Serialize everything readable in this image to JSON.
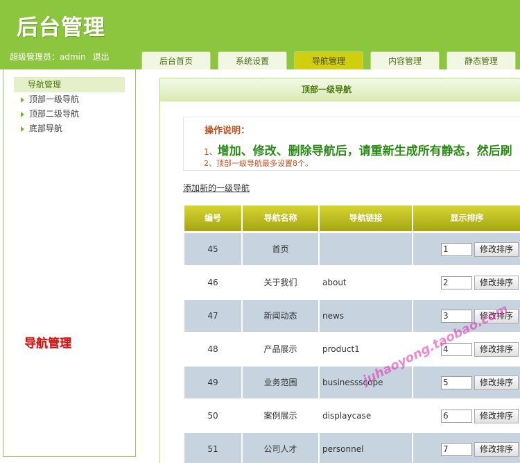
{
  "header": {
    "logo": "后台管理",
    "admin_text": "超级管理员：admin",
    "logout": "退出"
  },
  "tabs": [
    {
      "label": "后台首页",
      "active": false
    },
    {
      "label": "系统设置",
      "active": false
    },
    {
      "label": "导航管理",
      "active": true
    },
    {
      "label": "内容管理",
      "active": false
    },
    {
      "label": "静态管理",
      "active": false
    }
  ],
  "sidebar": {
    "title": "导航管理",
    "items": [
      {
        "label": "顶部一级导航"
      },
      {
        "label": "顶部二级导航"
      },
      {
        "label": "底部导航"
      }
    ],
    "side_label": "导航管理"
  },
  "panel": {
    "title": "顶部一级导航",
    "notice_title": "操作说明：",
    "notice_num1": "1、",
    "notice_line1": "增加、修改、删除导航后，请重新生成所有静态，然后刷",
    "notice_line2": "2、顶部一级导航最多设置8个。",
    "add_link": "添加新的一级导航"
  },
  "table": {
    "headers": [
      "编号",
      "导航名称",
      "导航链接",
      "显示排序"
    ],
    "button_label": "修改排序",
    "rows": [
      {
        "id": "45",
        "name": "首页",
        "link": "",
        "order": "1"
      },
      {
        "id": "46",
        "name": "关于我们",
        "link": "about",
        "order": "2"
      },
      {
        "id": "47",
        "name": "新闻动态",
        "link": "news",
        "order": "3"
      },
      {
        "id": "48",
        "name": "产品展示",
        "link": "product1",
        "order": "4"
      },
      {
        "id": "49",
        "name": "业务范围",
        "link": "businessscope",
        "order": "5"
      },
      {
        "id": "50",
        "name": "案例展示",
        "link": "displaycase",
        "order": "6"
      },
      {
        "id": "51",
        "name": "公司人才",
        "link": "personnel",
        "order": "7"
      }
    ]
  },
  "watermark": "juhaoyong.taobao.com",
  "colors": {
    "header_green": "#8cc63e",
    "tab_active": "#cfcf10",
    "row_alt": "#c7d4e0",
    "notice_orange": "#c0501e",
    "notice_green": "#2c8a16",
    "side_label_red": "#d81010"
  }
}
